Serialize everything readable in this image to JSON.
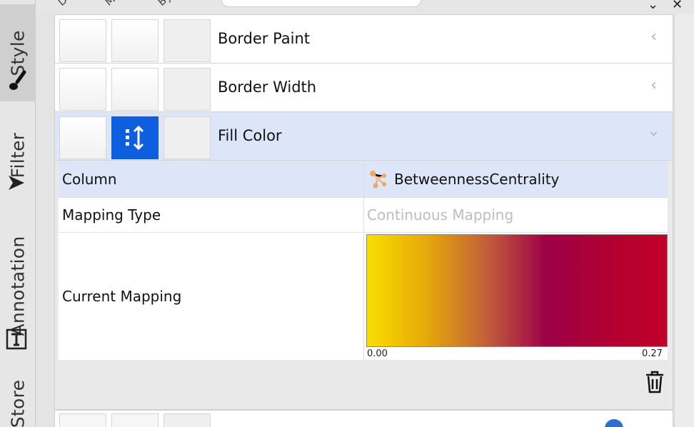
{
  "sidebar": {
    "tabs": [
      {
        "label": "Style",
        "icon": "paintbrush-icon",
        "active": true
      },
      {
        "label": "Filter",
        "icon": "funnel-icon",
        "active": false
      },
      {
        "label": "Annotation",
        "icon": "text-tool-icon",
        "active": false
      },
      {
        "label": "Store",
        "icon": "",
        "active": false
      }
    ]
  },
  "header": {
    "column_headers": [
      "D",
      "M",
      "By"
    ]
  },
  "properties": {
    "border_paint": {
      "label": "Border Paint"
    },
    "border_width": {
      "label": "Border Width"
    },
    "fill_color": {
      "label": "Fill Color"
    }
  },
  "mapping": {
    "column_key": "Column",
    "column_value": "BetweennessCentrality",
    "type_key": "Mapping Type",
    "type_value": "Continuous Mapping",
    "current_key": "Current Mapping",
    "range_min": "0.00",
    "range_max": "0.27",
    "gradient_colors": [
      "#f7df00",
      "#e6a80a",
      "#c25f3a",
      "#9c0047",
      "#b00032",
      "#c10028"
    ]
  },
  "colors": {
    "selected_row": "#dde6f8",
    "accent_blue": "#0d5fe0"
  }
}
